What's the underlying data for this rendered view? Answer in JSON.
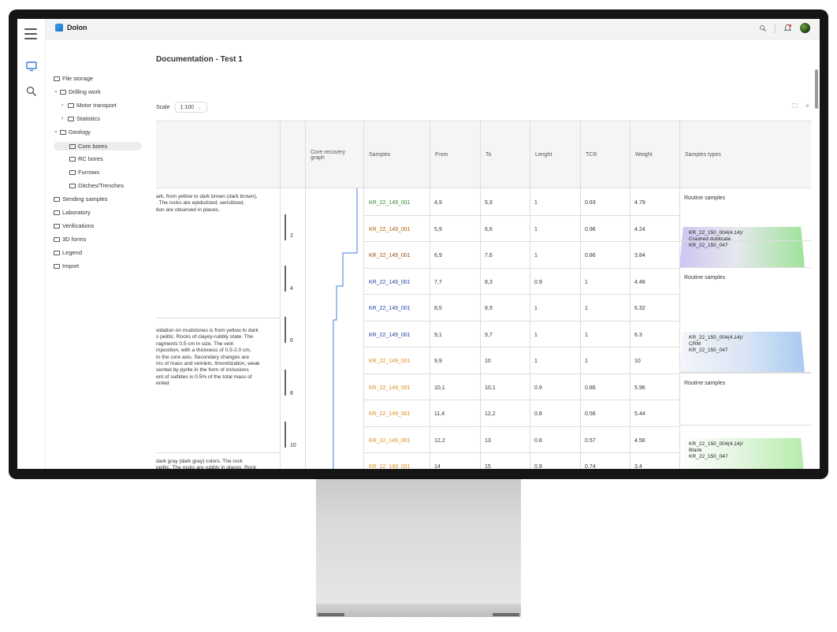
{
  "app": {
    "brand": "Dolon"
  },
  "tree": {
    "items": [
      {
        "label": "File storage",
        "chevron": ""
      },
      {
        "label": "Drilling work",
        "chevron": "v"
      },
      {
        "label": "Motor transport",
        "chevron": ">"
      },
      {
        "label": "Statistics",
        "chevron": ">"
      },
      {
        "label": "Geology",
        "chevron": "v"
      },
      {
        "label": "Core bores",
        "chevron": "",
        "active": true
      },
      {
        "label": "RC bores",
        "chevron": ""
      },
      {
        "label": "Furrows",
        "chevron": ""
      },
      {
        "label": "Ditches/Trenches",
        "chevron": ""
      },
      {
        "label": "Sending samples",
        "chevron": ""
      },
      {
        "label": "Laboratory",
        "chevron": ""
      },
      {
        "label": "Verifications",
        "chevron": ""
      },
      {
        "label": "3D forms",
        "chevron": ""
      },
      {
        "label": "Legend",
        "chevron": ""
      },
      {
        "label": "Import",
        "chevron": ""
      }
    ]
  },
  "doc": {
    "title": "Documentation - Test 1",
    "scale_label": "Scale",
    "scale_value": "1:100"
  },
  "table": {
    "headers": {
      "core": "Core recovery graph",
      "samples": "Samples",
      "from": "From",
      "to": "To",
      "length": "Lenght",
      "tcr": "TCR",
      "weight": "Weight",
      "types": "Samples types"
    },
    "rows": [
      {
        "sample": "KR_22_149_001",
        "color": "#2e8b2e",
        "from": "4,9",
        "to": "5,9",
        "len": "1",
        "tcr": "0.93",
        "weight": "4.79"
      },
      {
        "sample": "KR_22_149_001",
        "color": "#b35a00",
        "from": "5,9",
        "to": "6,6",
        "len": "1",
        "tcr": "0.96",
        "weight": "4.24"
      },
      {
        "sample": "KR_22_149_001",
        "color": "#9c4a12",
        "from": "6,9",
        "to": "7,6",
        "len": "1",
        "tcr": "0.86",
        "weight": "3.84"
      },
      {
        "sample": "KR_22_149_001",
        "color": "#1f3fa8",
        "from": "7,7",
        "to": "8,3",
        "len": "0.9",
        "tcr": "1",
        "weight": "4.48"
      },
      {
        "sample": "KR_22_149_001",
        "color": "#1f3fa8",
        "from": "8,5",
        "to": "8,9",
        "len": "1",
        "tcr": "1",
        "weight": "6.32"
      },
      {
        "sample": "KR_22_149_001",
        "color": "#1f3fa8",
        "from": "9,1",
        "to": "9,7",
        "len": "1",
        "tcr": "1",
        "weight": "6.3"
      },
      {
        "sample": "KR_22_149_001",
        "color": "#e08a1a",
        "from": "9,9",
        "to": "10",
        "len": "1",
        "tcr": "1",
        "weight": "10"
      },
      {
        "sample": "KR_22_149_001",
        "color": "#e08a1a",
        "from": "10,1",
        "to": "10,1",
        "len": "0.9",
        "tcr": "0.86",
        "weight": "5.96"
      },
      {
        "sample": "KR_22_149_001",
        "color": "#e08a1a",
        "from": "11,4",
        "to": "12,2",
        "len": "0.8",
        "tcr": "0.56",
        "weight": "5.44"
      },
      {
        "sample": "KR_22_149_001",
        "color": "#e08a1a",
        "from": "12,2",
        "to": "13",
        "len": "0.8",
        "tcr": "0.57",
        "weight": "4.56"
      },
      {
        "sample": "KR_22_149_001",
        "color": "#e08a1a",
        "from": "14",
        "to": "15",
        "len": "0.9",
        "tcr": "0.74",
        "weight": "3.4"
      }
    ],
    "depths": [
      "2",
      "4",
      "6",
      "8",
      "10"
    ],
    "descriptions": [
      "ark, from yellow to dark brown (dark brown),\n. The rocks are epidozized, sericitized,\ntion are observed in places.",
      "xidation on mudstones is from yellow to dark\ns pelitic. Rocks of clayey-rubbly state. The\nragments 0.5 cm in size. The vein\nmposition, with a thickness of 0.5-2.0 cm,\nto the core axis. Secondary changes are\nms of mass and veinlets, limonitization, weak\nsented by pyrite in the form of inclusions\nent of sulfides is 0.5% of the total mass of\nented",
      " dark gray (dark gray) colors. The rock\n pelitic. The rocks are rubbly in places. Rock\nr the entire interval)."
    ],
    "types": {
      "routine": "Routine samples",
      "badge1": "KR_22_150_004(4.14)/\nCrashed dublicate\nKR_22_150_047",
      "badge2": "KR_22_150_004(4.14)/\nCRM\nKR_22_150_047",
      "badge3": "KR_22_150_004(4.14)/\nBlank\nKR_22_150_047"
    }
  },
  "colors": {
    "core_line": "#3b7fe0"
  }
}
